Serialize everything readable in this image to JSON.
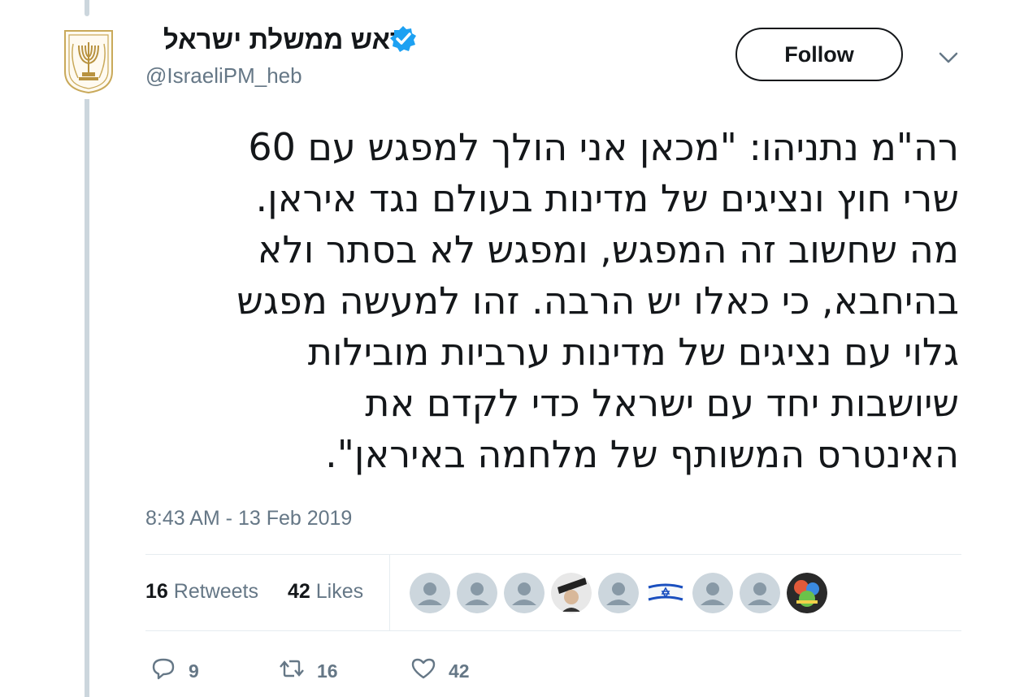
{
  "tweet": {
    "author_name": "ראש ממשלת ישראל",
    "handle": "@IsraeliPM_heb",
    "follow_label": "Follow",
    "text_lines": [
      "רה\"מ נתניהו: \"מכאן אני הולך למפגש עם 60",
      "שרי חוץ ונציגים של מדינות בעולם נגד איראן.",
      "מה שחשוב זה המפגש, ומפגש לא בסתר ולא",
      "בהיחבא, כי כאלו יש הרבה. זהו למעשה מפגש",
      "גלוי עם נציגים של מדינות ערביות מובילות",
      "שיושבות יחד עם ישראל כדי לקדם את",
      "האינטרס המשותף של מלחמה באיראן\"."
    ],
    "timestamp": "8:43 AM - 13 Feb 2019",
    "stats": {
      "retweets_count": "16",
      "retweets_label": "Retweets",
      "likes_count": "42",
      "likes_label": "Likes"
    },
    "actions": {
      "reply_count": "9",
      "retweet_count": "16",
      "like_count": "42"
    }
  },
  "icons": {
    "verified": "verified-badge-icon",
    "caret": "chevron-down-icon",
    "reply": "reply-icon",
    "retweet": "retweet-icon",
    "like": "heart-icon"
  },
  "colors": {
    "verified_blue": "#1da1f2",
    "secondary_text": "#657786",
    "divider": "#e6ecf0",
    "thread_line": "#ccd6dd"
  }
}
